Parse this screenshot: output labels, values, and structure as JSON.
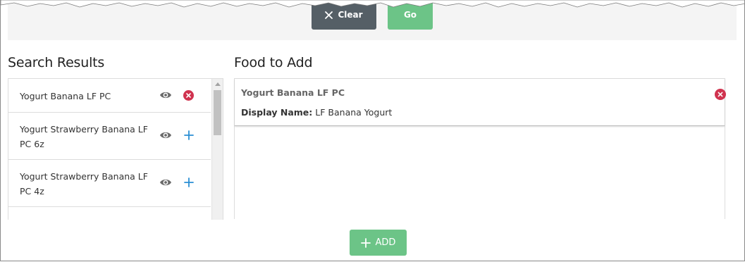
{
  "toolbar": {
    "clear_label": "Clear",
    "go_label": "Go"
  },
  "search_results": {
    "title": "Search Results",
    "items": [
      {
        "label": "Yogurt Banana LF PC",
        "action": "remove"
      },
      {
        "label": "Yogurt Strawberry Banana LF PC 6z",
        "action": "add"
      },
      {
        "label": "Yogurt Strawberry Banana LF PC 4z",
        "action": "add"
      }
    ]
  },
  "food_to_add": {
    "title": "Food to Add",
    "items": [
      {
        "name": "Yogurt Banana LF PC",
        "display_name_label": "Display Name:",
        "display_name_value": "LF Banana Yogurt"
      }
    ]
  },
  "footer": {
    "add_label": "ADD"
  },
  "colors": {
    "clear_button": "#555f66",
    "go_button": "#6cc487",
    "add_button": "#6cc487",
    "remove_icon": "#d0334f",
    "add_icon": "#2a8fd4",
    "eye_icon": "#6a6a6a"
  }
}
